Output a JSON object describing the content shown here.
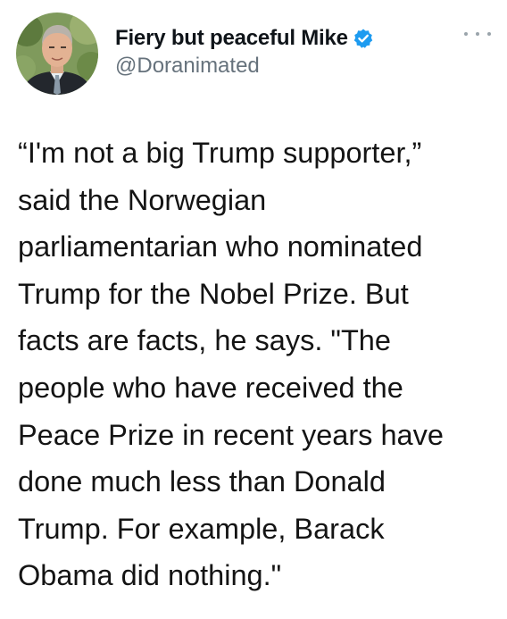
{
  "author": {
    "display_name": "Fiery but peaceful Mike",
    "handle": "@Doranimated",
    "verified": true,
    "avatar_icon": "profile-photo-man-suit"
  },
  "menu": {
    "icon": "more-options-icon"
  },
  "tweet": {
    "lines": [
      "“I'm not a big Trump supporter,”",
      "said the Norwegian",
      "parliamentarian who nominated",
      "Trump for the Nobel Prize. But",
      "facts are facts, he says. \"The",
      "people who have received the",
      "Peace Prize in recent years have",
      "done much less than Donald",
      "Trump. For example, Barack",
      "Obama did nothing.\""
    ]
  },
  "colors": {
    "verified_badge": "#1d9bf0",
    "handle_text": "#66727c",
    "body_text": "#141414"
  }
}
